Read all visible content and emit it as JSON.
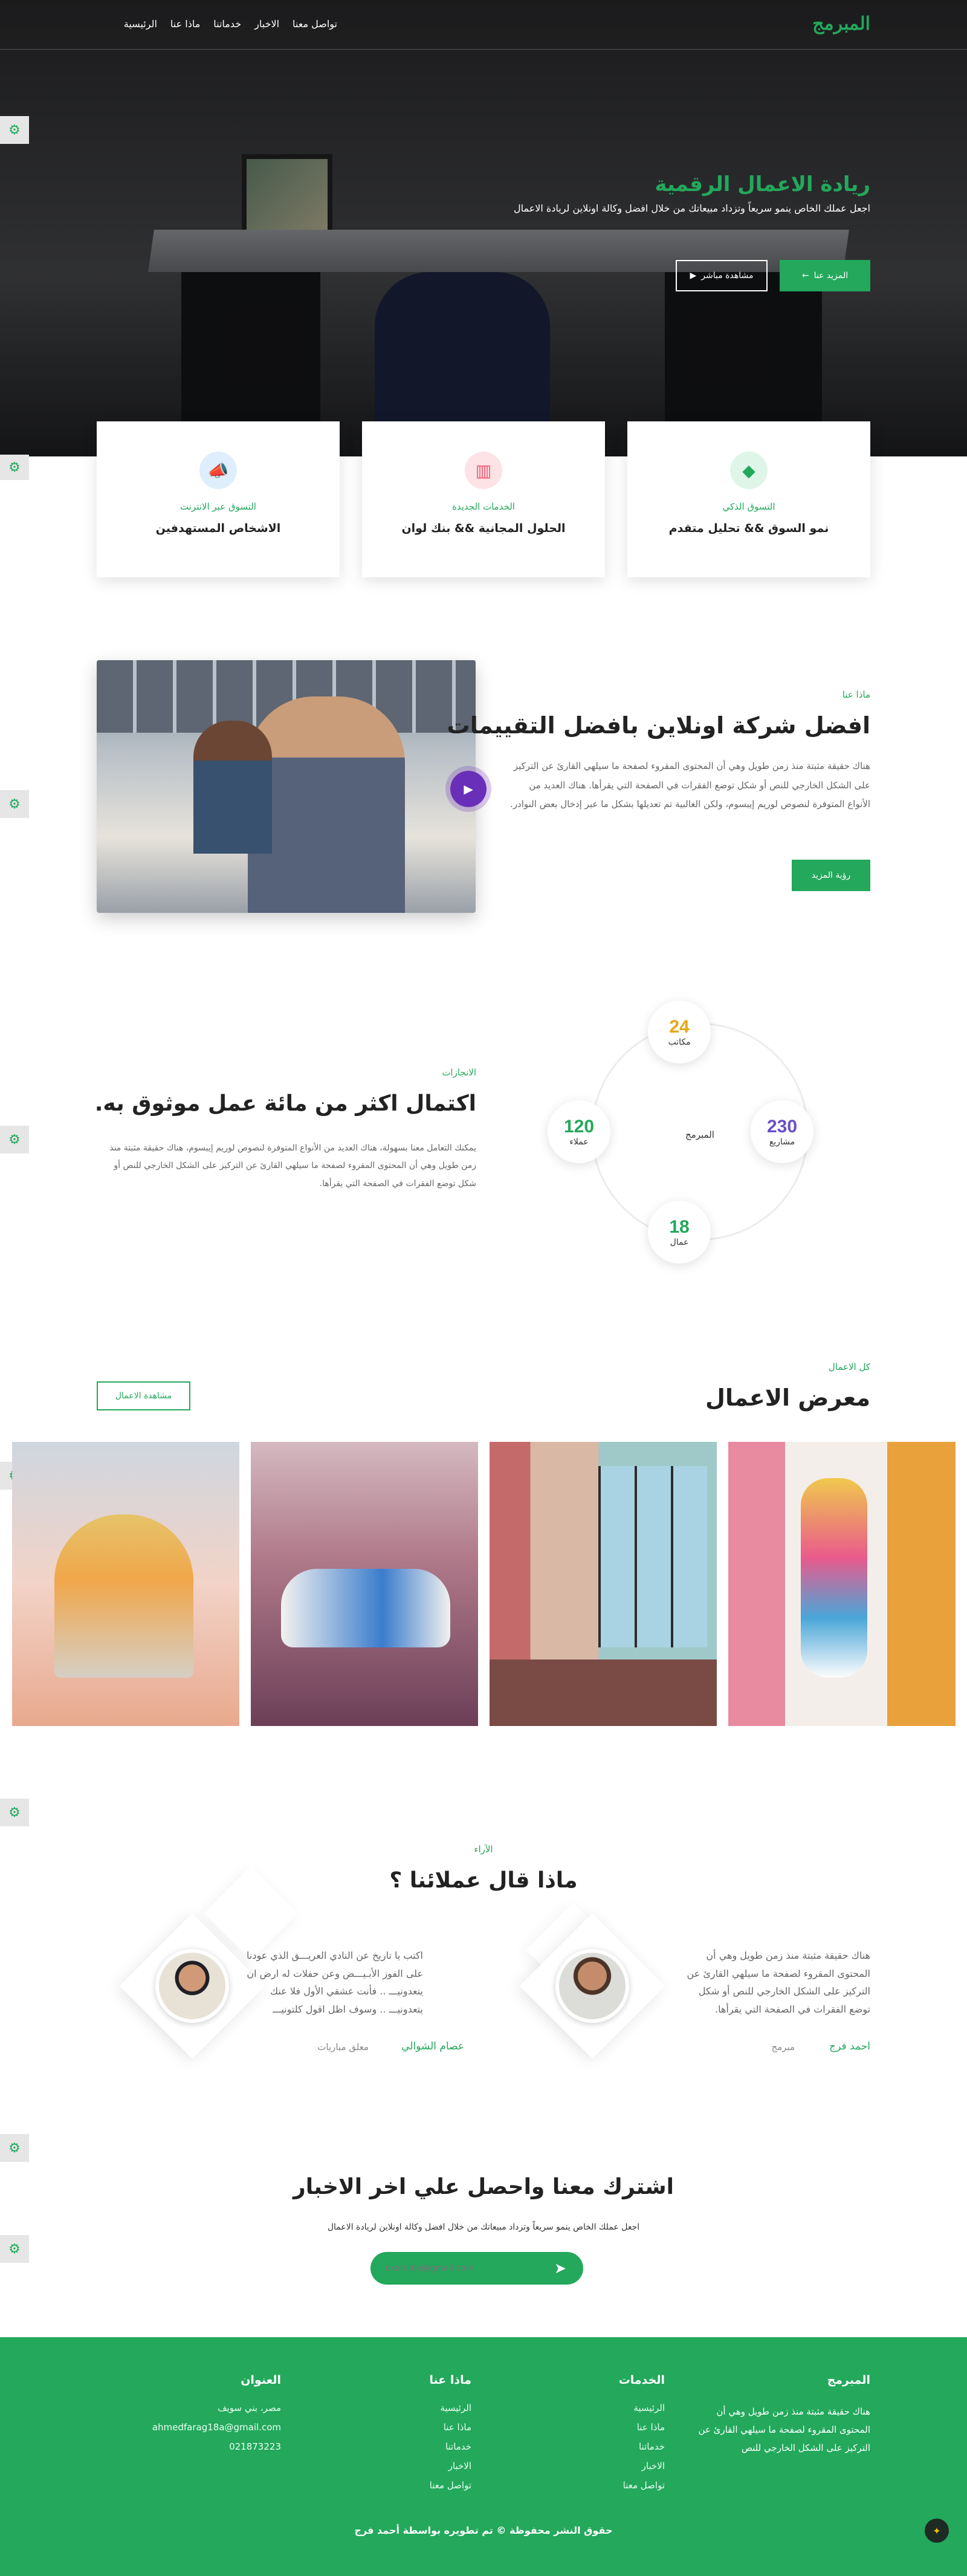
{
  "nav": {
    "logo": "المبرمج",
    "items": [
      "الرئيسية",
      "ماذا عنا",
      "خدماتنا",
      "الاخبار",
      "تواصل معنا"
    ]
  },
  "hero": {
    "title": "ريادة الاعمال الرقمية",
    "subtitle": "اجعل عملك الخاص ينمو سريعاً وتزداد مبيعاتك من خلال افضل وكالة اونلاين لريادة الاعمال",
    "primary_btn": "المزيد عنا",
    "secondary_btn": "مشاهدة مباشر"
  },
  "services": [
    {
      "kicker": "التسوق الذكي",
      "title": "نمو السوق && تحليل متقدم",
      "icon": "diamond-icon",
      "color": "#23a85c",
      "bg": "#dff5e8"
    },
    {
      "kicker": "الخدمات الجديدة",
      "title": "الحلول المجانية && بنك لوان",
      "icon": "chart-icon",
      "color": "#f0566c",
      "bg": "#fde2e6"
    },
    {
      "kicker": "التسوق عبر الانترنت",
      "title": "الاشخاص المستهدفين",
      "icon": "megaphone-icon",
      "color": "#3a8ee6",
      "bg": "#dfeefc"
    }
  ],
  "about": {
    "kicker": "ماذا عنا",
    "title": "افضل شركة اونلاين بافضل التقييمات",
    "paragraph": "هناك حقيقة مثبتة منذ زمن طويل وهي أن المحتوى المقروء لصفحة ما سيلهي القارئ عن التركيز على الشكل الخارجي للنص أو شكل توضع الفقرات في الصفحة التي يقرأها. هناك العديد من الأنواع المتوفرة لنصوص لوريم إيبسوم، ولكن الغالبية تم تعديلها بشكل ما عبر إدخال بعض النوادر.",
    "button": "رؤية المزيد"
  },
  "stats": {
    "kicker": "الانجازات",
    "title": "اكتمال اكثر من مائة عمل موثوق به.",
    "paragraph": "يمكنك التعامل معنا بسهولة، هناك العديد من الأنواع المتوفرة لنصوص لوريم إيبسوم، هناك حقيقة مثبتة منذ زمن طويل وهي أن المحتوى المقروء لصفحة ما سيلهي القارئ عن التركيز على الشكل الخارجي للنص أو شكل توضع الفقرات في الصفحة التي يقرأها.",
    "center": "المبرمج",
    "items": [
      {
        "value": "24",
        "label": "مكاتب",
        "color": "#e6a817"
      },
      {
        "value": "230",
        "label": "مشاريع",
        "color": "#6a4fc8"
      },
      {
        "value": "18",
        "label": "عمال",
        "color": "#23a85c"
      },
      {
        "value": "120",
        "label": "عملاء",
        "color": "#23a85c"
      }
    ]
  },
  "portfolio": {
    "kicker": "كل الاعمال",
    "title": "معرض الاعمال",
    "button": "مشاهدة الاعمال"
  },
  "testimonials": {
    "kicker": "الآراء",
    "title": "ماذا قال عملائنا ؟",
    "items": [
      {
        "quote": "هناك حقيقة مثبتة منذ زمن طويل وهي أن المحتوى المقروء لصفحة ما سيلهي القارئ عن التركيز على الشكل الخارجي للنص أو شكل توضع الفقرات في الصفحة التي يقرأها.",
        "name": "احمد فرج",
        "role": "مبرمج"
      },
      {
        "quote": "اكتب يا تاريخ عن النادي العريـــق الذي عودنا على الفوز الأبـيـــض وعن حفلات له ارض ان يتعدونيـــ .. فأنت عشقي الأول فلا عنك يتعدونيـــ .. وسوف اظل اقول كلتونيـــ",
        "name": "عصام الشوالي",
        "role": "معلق مباريات"
      }
    ]
  },
  "newsletter": {
    "title": "اشترك معنا واحصل علي اخر الاخبار",
    "subtitle": "اجعل عملك الخاص ينمو سريعاً وتزداد مبيعاتك من خلال افضل وكالة اونلاين لريادة الاعمال",
    "placeholder": "example@gmail.com"
  },
  "footer": {
    "brand_title": "المبرمج",
    "brand_text": "هناك حقيقة مثبتة منذ زمن طويل وهي أن المحتوى المقروء لصفحة ما سيلهي القارئ عن التركيز على الشكل الخارجي للنص",
    "services_title": "الخدمات",
    "services": [
      "الرئيسية",
      "ماذا عنا",
      "خدماتنا",
      "الاخبار",
      "تواصل معنا"
    ],
    "about_title": "ماذا عنا",
    "about": [
      "الرئيسية",
      "ماذا عنا",
      "خدماتنا",
      "الاخبار",
      "تواصل معنا"
    ],
    "address_title": "العنوان",
    "address": [
      "مصر، بني سويف",
      "ahmedfarag18a@gmail.com",
      "021873223"
    ],
    "copyright": "حقوق النشر محفوظة © تم تطويره بواسطة أحمد فرج"
  }
}
